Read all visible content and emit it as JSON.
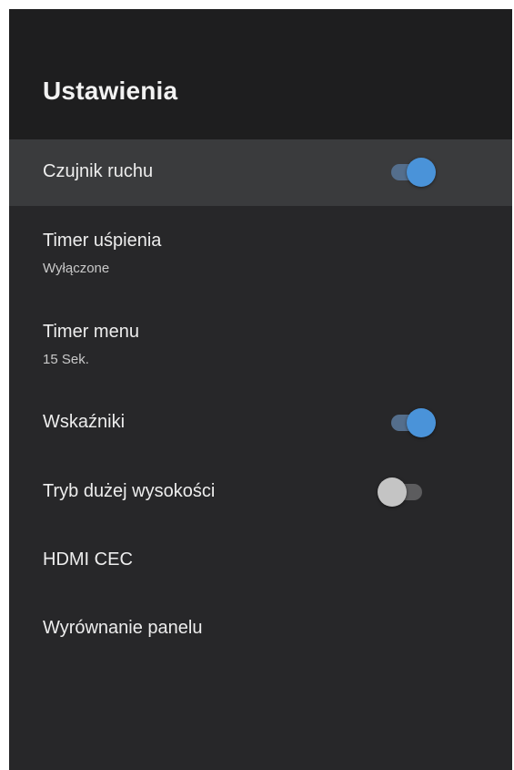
{
  "header": {
    "title": "Ustawienia"
  },
  "settings": [
    {
      "label": "Czujnik ruchu",
      "toggle": "on"
    },
    {
      "label": "Timer uśpienia",
      "value": "Wyłączone"
    },
    {
      "label": "Timer menu",
      "value": "15 Sek."
    },
    {
      "label": "Wskaźniki",
      "toggle": "on"
    },
    {
      "label": "Tryb dużej wysokości",
      "toggle": "off"
    },
    {
      "label": "HDMI CEC"
    },
    {
      "label": "Wyrównanie panelu"
    }
  ],
  "colors": {
    "background": "#272729",
    "header_background": "#1e1e1f",
    "focused_row": "#3a3b3d",
    "toggle_on_knob": "#4a93d9",
    "toggle_on_track": "#546e8c",
    "toggle_off_knob": "#c4c4c4",
    "toggle_off_track": "#5c5c5e"
  }
}
